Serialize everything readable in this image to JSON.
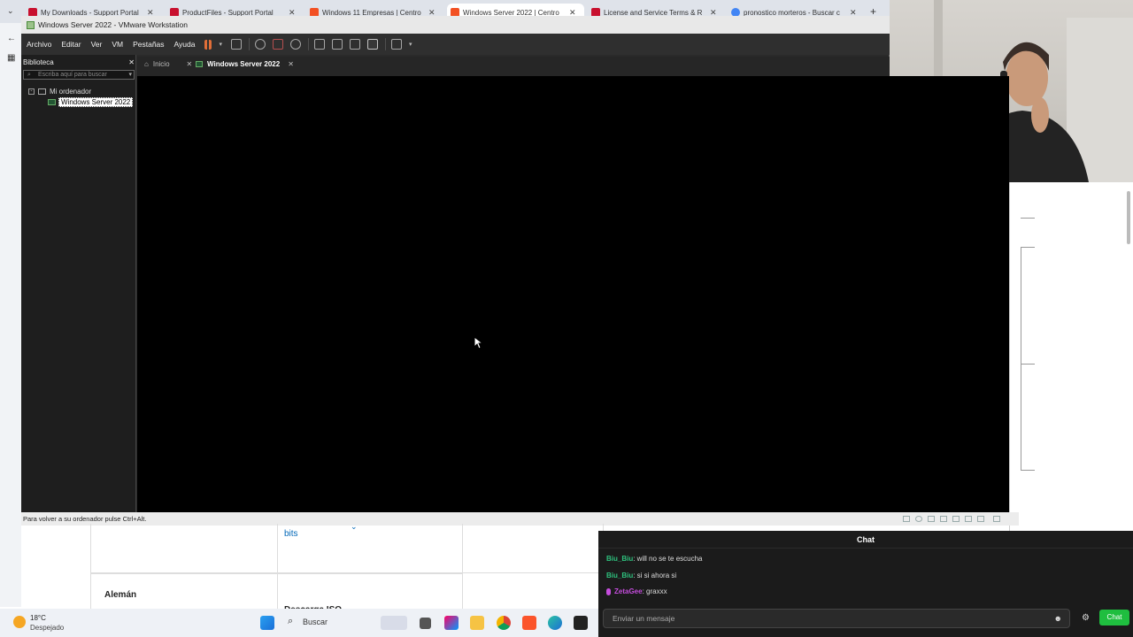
{
  "browser": {
    "tabs": [
      {
        "title": "My Downloads - Support Portal",
        "favicon_color": "#c8102e",
        "active": false
      },
      {
        "title": "ProductFiles - Support Portal",
        "favicon_color": "#c8102e",
        "active": false
      },
      {
        "title": "Windows 11 Empresas | Centro",
        "favicon_color": "#f25022",
        "active": false
      },
      {
        "title": "Windows Server 2022 | Centro",
        "favicon_color": "#f25022",
        "active": true
      },
      {
        "title": "License and Service Terms & R",
        "favicon_color": "#c8102e",
        "active": false
      },
      {
        "title": "pronostico morteros - Buscar c",
        "favicon_color": "#4285f4",
        "active": false
      }
    ],
    "new_tab": "+"
  },
  "vmware": {
    "window_title": "Windows Server 2022 - VMware Workstation",
    "menu": [
      "Archivo",
      "Editar",
      "Ver",
      "VM",
      "Pestañas",
      "Ayuda"
    ],
    "library": {
      "title": "Biblioteca",
      "search_placeholder": "Escriba aquí para buscar",
      "root": "Mi ordenador",
      "vm": "Windows Server 2022"
    },
    "tabs": [
      {
        "label": "Inicio",
        "selected": false
      },
      {
        "label": "Windows Server 2022",
        "selected": true
      }
    ],
    "status": "Para volver a su ordenador pulse Ctrl+Alt."
  },
  "page": {
    "bits_label": "bits",
    "row_label": "Alemán",
    "partial_text": "Descarga ISO"
  },
  "chat": {
    "title": "Chat",
    "messages": [
      {
        "user": "Biu_Biu",
        "text": ": will no se te escucha",
        "color": "#2ec27e"
      },
      {
        "user": "Biu_Biu",
        "text": ": si si ahora si",
        "color": "#2ec27e"
      },
      {
        "user": "ZetaGee",
        "text": ": graxxx",
        "color": "#c54ddd"
      }
    ],
    "input_placeholder": "Enviar un mensaje",
    "send_label": "Chat"
  },
  "taskbar": {
    "weather_temp": "18°C",
    "weather_desc": "Despejado",
    "search_label": "Buscar"
  }
}
